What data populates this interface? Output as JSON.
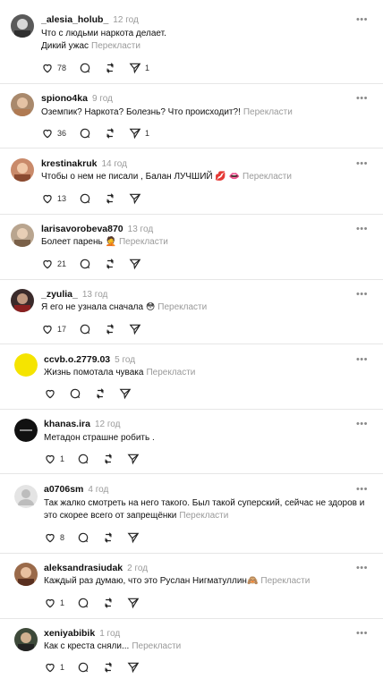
{
  "labels": {
    "translate": "Перекласти"
  },
  "comments": [
    {
      "username": "_alesia_holub_",
      "time": "12 год",
      "text": "Что с людьми наркота делает.",
      "text2": "Дикий ужас",
      "likes": "78",
      "reposts": "",
      "shares": "1"
    },
    {
      "username": "spiono4ka",
      "time": "9 год",
      "text": "Оземпик? Наркота? Болезнь? Что происходит?!",
      "likes": "36",
      "reposts": "",
      "shares": "1"
    },
    {
      "username": "krestinakruk",
      "time": "14 год",
      "text": "Чтобы о нем не писали , Балан ЛУЧШИЙ 💋 👄",
      "likes": "13",
      "reposts": "",
      "shares": ""
    },
    {
      "username": "larisavorobeva870",
      "time": "13 год",
      "text": "Болеет парень 🤦",
      "likes": "21",
      "reposts": "",
      "shares": ""
    },
    {
      "username": "_zyulia_",
      "time": "13 год",
      "text": "Я его не узнала сначала 😳",
      "likes": "17",
      "reposts": "",
      "shares": ""
    },
    {
      "username": "ccvb.o.2779.03",
      "time": "5 год",
      "text": "Жизнь помотала чувака",
      "likes": "",
      "reposts": "",
      "shares": ""
    },
    {
      "username": "khanas.ira",
      "time": "12 год",
      "text": "Метадон страшне робить .",
      "likes": "1",
      "reposts": "",
      "shares": ""
    },
    {
      "username": "a0706sm",
      "time": "4 год",
      "text": "Так жалко смотреть на него такого. Был такой суперский, сейчас не здоров и",
      "text2": "это скорее всего от запрещёнки",
      "likes": "8",
      "reposts": "",
      "shares": ""
    },
    {
      "username": "aleksandrasiudak",
      "time": "2 год",
      "text": "Каждый раз думаю, что это Руслан Нигматуллин🙈",
      "likes": "1",
      "reposts": "",
      "shares": ""
    },
    {
      "username": "xeniyabibik",
      "time": "1 год",
      "text": "Как с креста сняли...",
      "likes": "1",
      "reposts": "",
      "shares": ""
    }
  ],
  "icons": {
    "like": "heart-icon",
    "reply": "comment-icon",
    "repost": "repost-icon",
    "share": "send-icon",
    "more": "more-icon"
  },
  "colors": {
    "translate": "#9a9a9a",
    "time": "#9a9a9a",
    "divider": "#e6e6e6"
  }
}
